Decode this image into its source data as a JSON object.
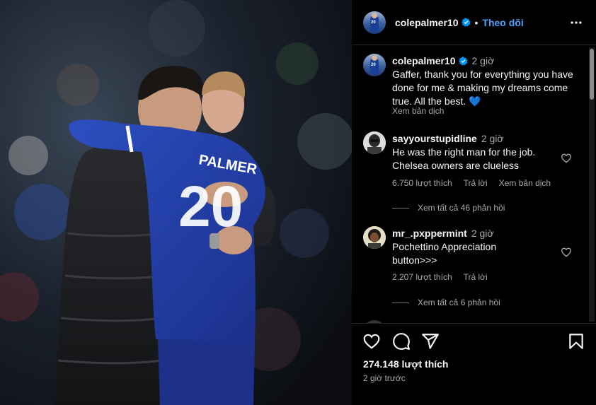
{
  "header": {
    "username": "colepalmer10",
    "separator": "•",
    "follow_label": "Theo dõi",
    "avatar_number": "20"
  },
  "caption": {
    "username": "colepalmer10",
    "time": "2 giờ",
    "text": "Gaffer, thank you for everything you have done for me & making my dreams come true. All the best. 💙",
    "translate_label": "Xem bản dịch"
  },
  "comments": [
    {
      "username": "sayyourstupidline",
      "time": "2 giờ",
      "text": "He was the right man for the job. Chelsea owners are clueless",
      "likes": "6.750 lượt thích",
      "reply_label": "Trả lời",
      "translate_label": "Xem bản dịch",
      "replies_label": "Xem tất cả 46 phản hồi"
    },
    {
      "username": "mr_.pxppermint",
      "time": "2 giờ",
      "text": "Pochettino Appreciation button>>>",
      "likes": "2.207 lượt thích",
      "reply_label": "Trả lời",
      "replies_label": "Xem tất cả 6 phản hồi"
    }
  ],
  "footer": {
    "likes": "274.148 lượt thích",
    "posted": "2 giờ trước"
  },
  "photo": {
    "jersey_name": "PALMER",
    "jersey_number": "20"
  },
  "icons": {
    "verified": "verified-badge-icon",
    "more": "more-options-icon",
    "like": "heart-icon",
    "comment": "comment-icon",
    "share": "share-icon",
    "save": "bookmark-icon"
  },
  "colors": {
    "accent": "#4aa3ff",
    "background": "#000000",
    "muted": "#a8a8a8",
    "heart": "#3d8bff"
  }
}
